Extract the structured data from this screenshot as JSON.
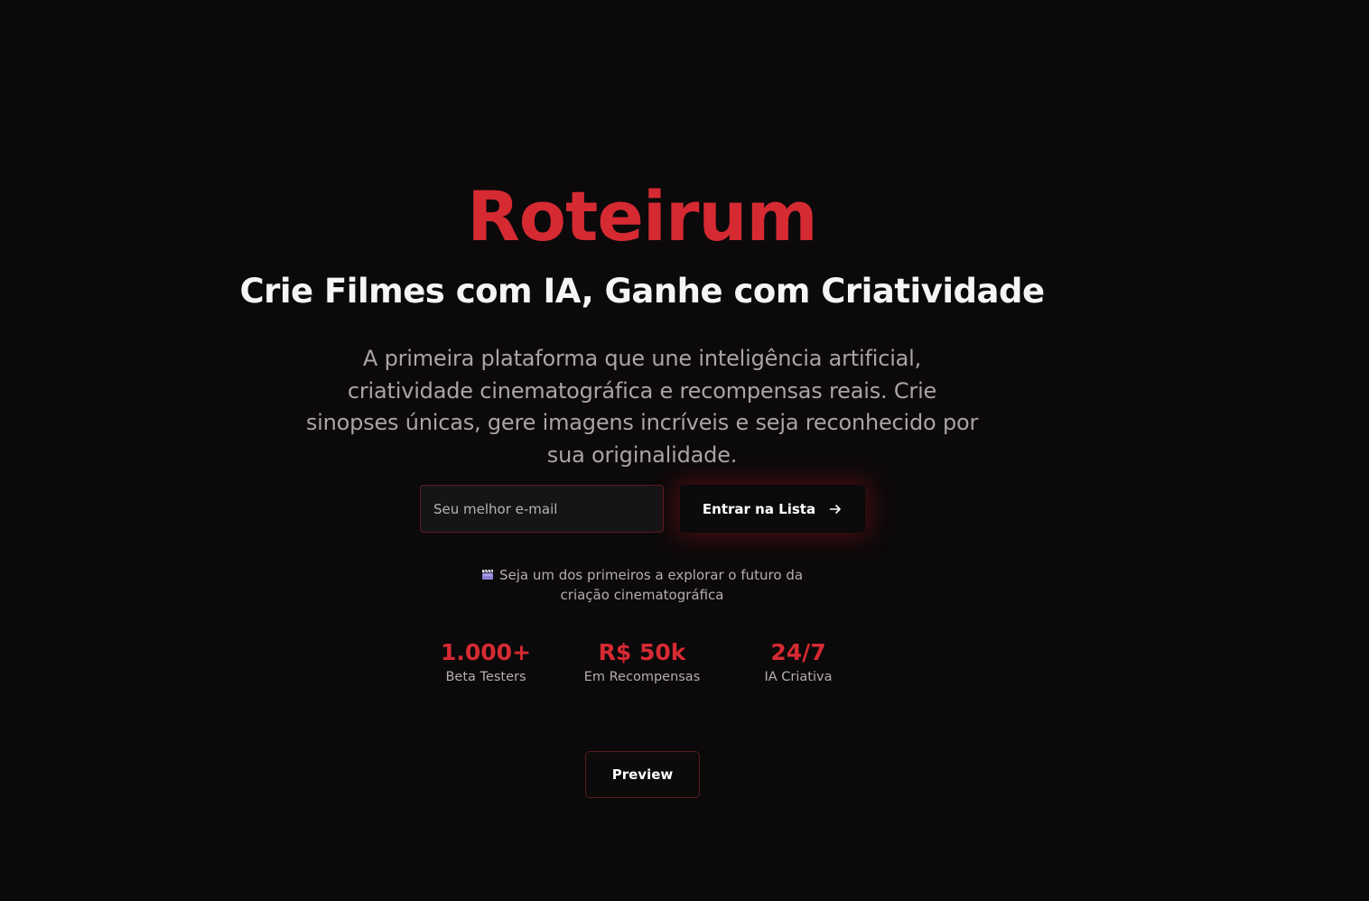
{
  "brand": "Roteirum",
  "tagline": "Crie Filmes com IA, Ganhe com Criatividade",
  "description": "A primeira plataforma que une inteligência artificial, criatividade cinematográfica e recompensas reais. Crie sinopses únicas, gere imagens incríveis e seja reconhecido por sua originalidade.",
  "signup": {
    "email_placeholder": "Seu melhor e-mail",
    "email_value": "",
    "button_label": "Entrar na Lista",
    "button_icon": "arrow-right-icon"
  },
  "note": {
    "icon": "clapperboard-icon",
    "text": "Seja um dos primeiros a explorar o futuro da criação cinematográfica"
  },
  "stats": [
    {
      "value": "1.000+",
      "label": "Beta Testers"
    },
    {
      "value": "R$ 50k",
      "label": "Em Recompensas"
    },
    {
      "value": "24/7",
      "label": "IA Criativa"
    }
  ],
  "preview_label": "Preview",
  "colors": {
    "background": "#0b090a",
    "accent": "#d62a33",
    "text_primary": "#f5f5f5",
    "text_muted": "#a9a4a6",
    "border_accent": "#5a1c20"
  }
}
